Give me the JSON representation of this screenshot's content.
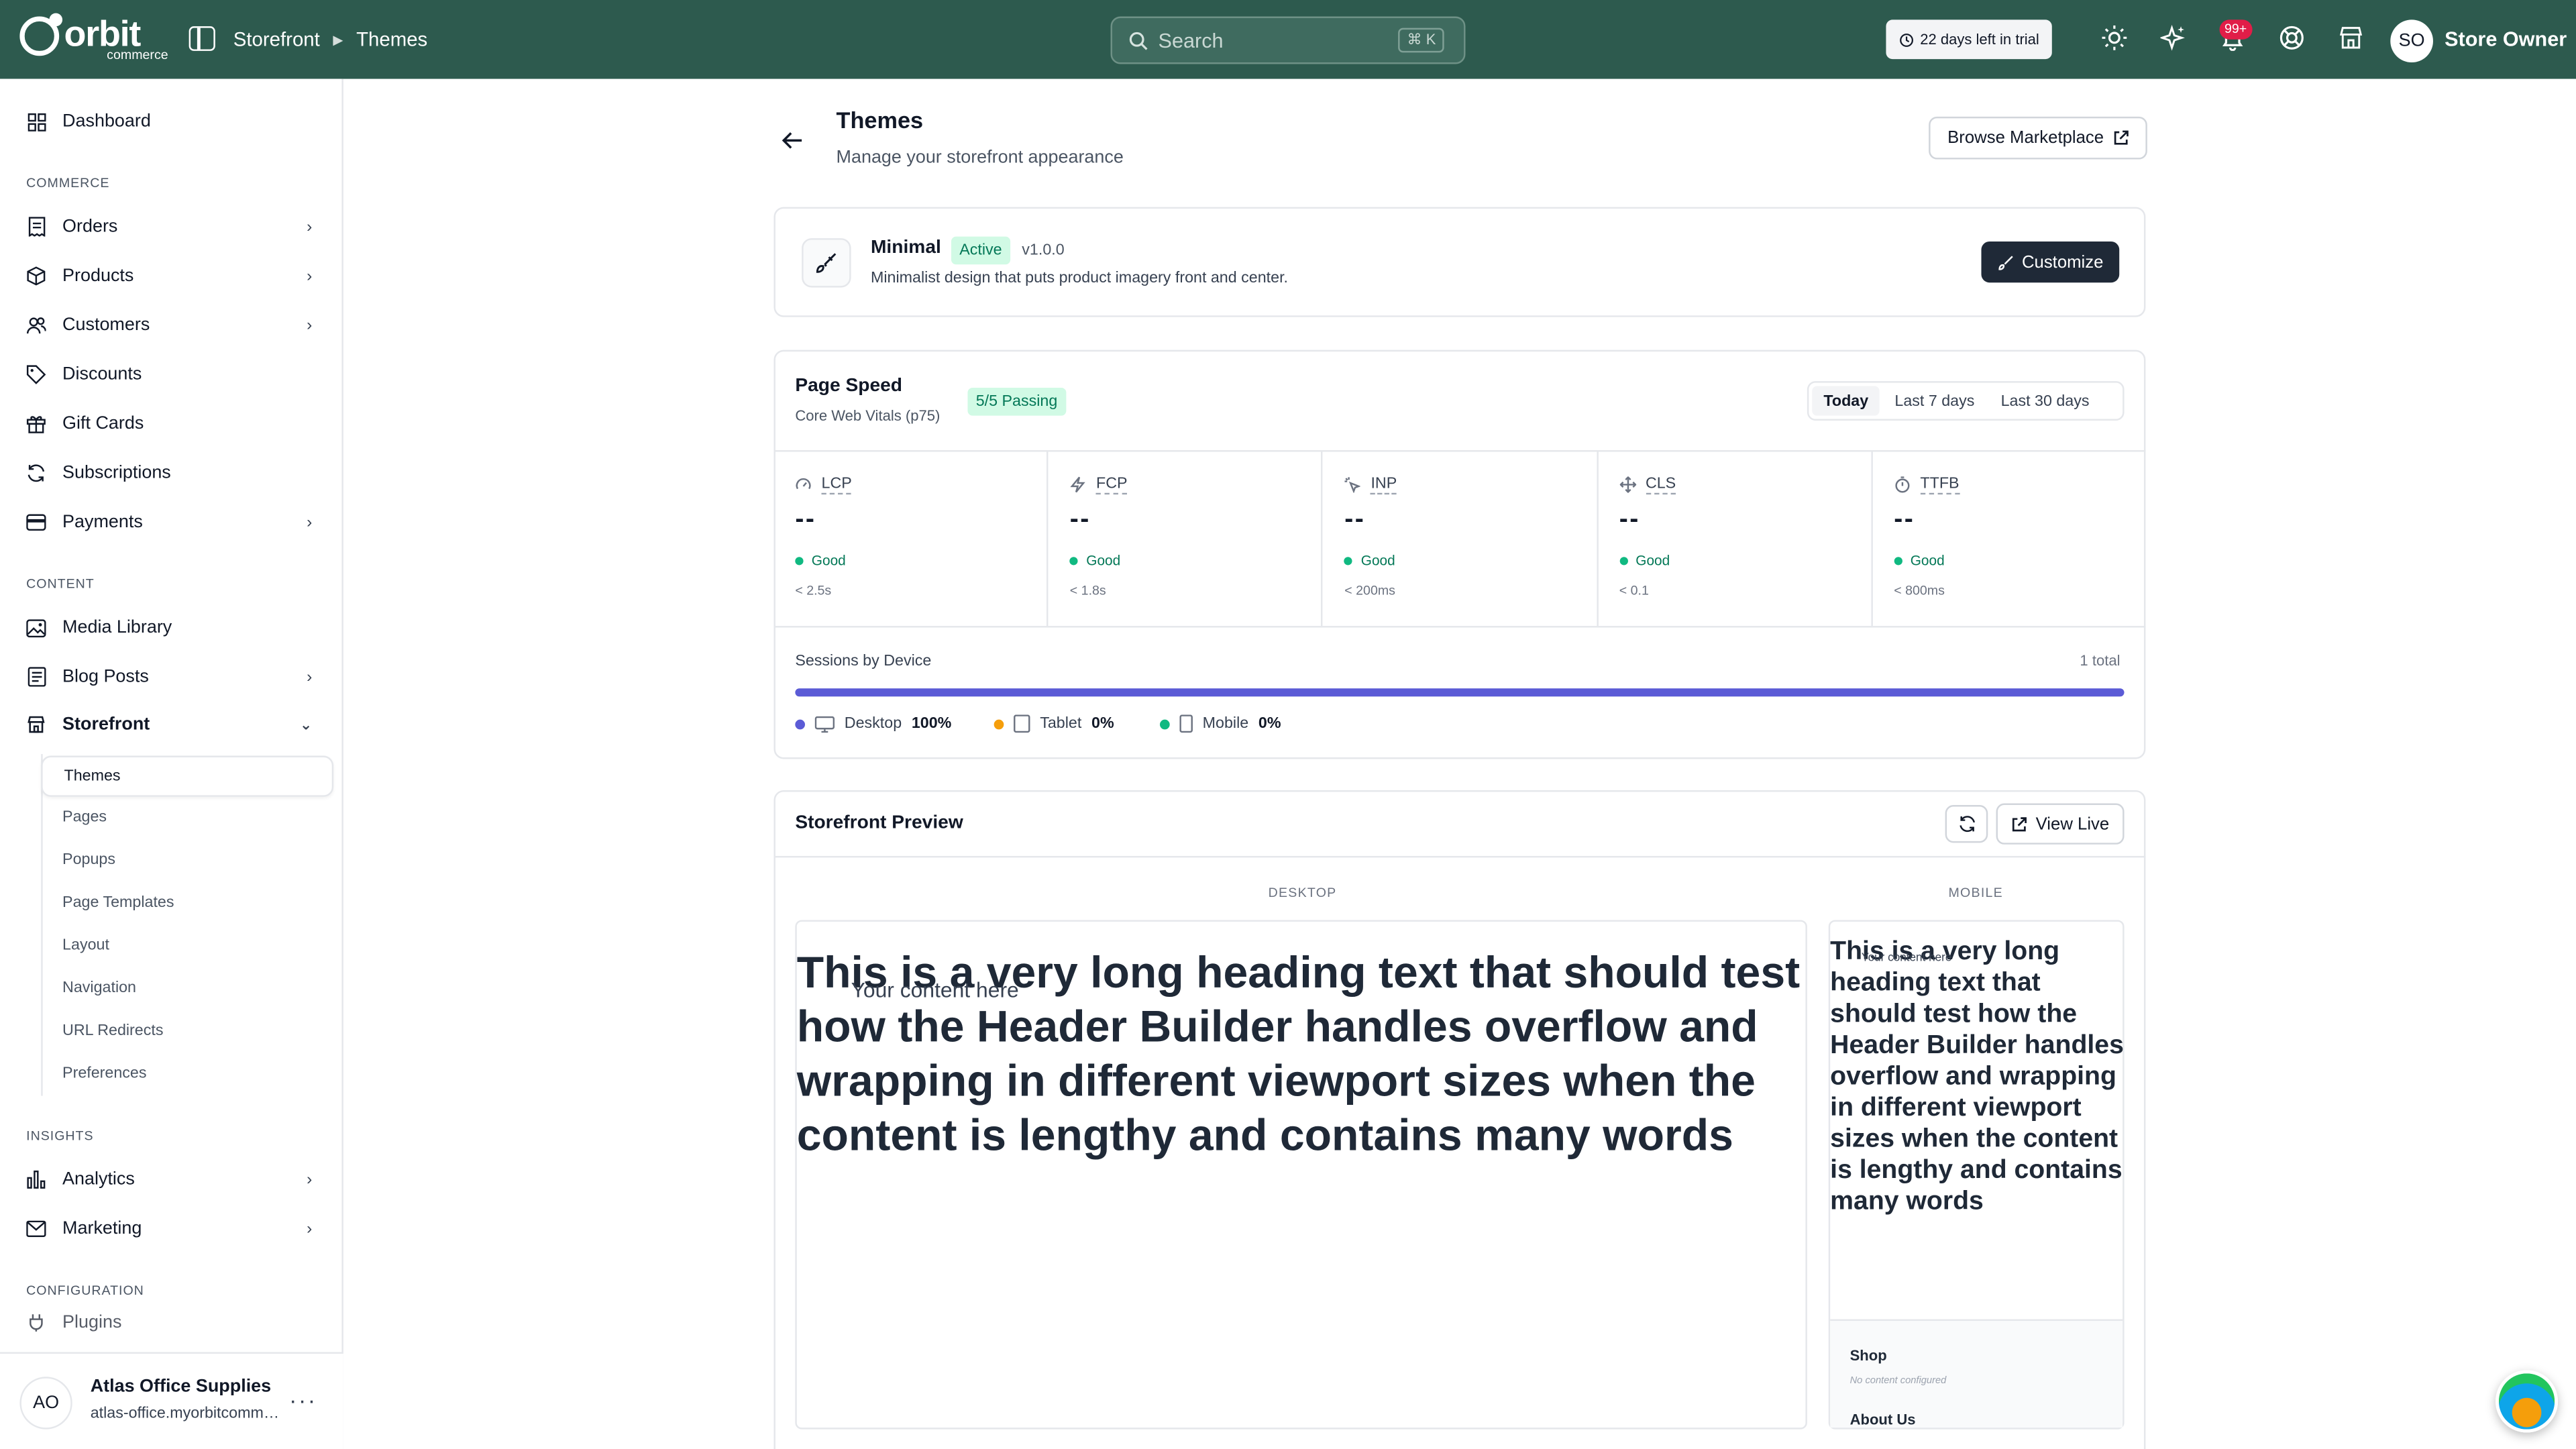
{
  "topbar": {
    "logo_text": "orbit",
    "logo_sub": "commerce",
    "breadcrumb": [
      "Storefront",
      "Themes"
    ],
    "search_placeholder": "Search",
    "search_shortcut": "⌘ K",
    "trial_text": "22 days left in trial",
    "notifications_badge": "99+",
    "avatar_initials": "SO",
    "user_name": "Store Owner"
  },
  "sidebar": {
    "dashboard": "Dashboard",
    "sections": {
      "commerce": "COMMERCE",
      "content": "CONTENT",
      "insights": "INSIGHTS",
      "configuration": "CONFIGURATION"
    },
    "commerce_items": [
      "Orders",
      "Products",
      "Customers",
      "Discounts",
      "Gift Cards",
      "Subscriptions",
      "Payments"
    ],
    "content_items": [
      "Media Library",
      "Blog Posts",
      "Storefront"
    ],
    "storefront_sub": [
      "Themes",
      "Pages",
      "Popups",
      "Page Templates",
      "Layout",
      "Navigation",
      "URL Redirects",
      "Preferences"
    ],
    "insights_items": [
      "Analytics",
      "Marketing"
    ],
    "config_partial": "Plugins",
    "org": {
      "initials": "AO",
      "name": "Atlas Office Supplies",
      "url": "atlas-office.myorbitcommerce.com"
    }
  },
  "page": {
    "title": "Themes",
    "subtitle": "Manage your storefront appearance",
    "browse_button": "Browse Marketplace"
  },
  "theme": {
    "name": "Minimal",
    "status": "Active",
    "version": "v1.0.0",
    "description": "Minimalist design that puts product imagery front and center.",
    "customize_button": "Customize"
  },
  "page_speed": {
    "title": "Page Speed",
    "subtitle": "Core Web Vitals (p75)",
    "passing": "5/5 Passing",
    "ranges": [
      "Today",
      "Last 7 days",
      "Last 30 days"
    ],
    "selected_range": "Today",
    "metrics": [
      {
        "label": "LCP",
        "value": "--",
        "status": "Good",
        "threshold": "< 2.5s"
      },
      {
        "label": "FCP",
        "value": "--",
        "status": "Good",
        "threshold": "< 1.8s"
      },
      {
        "label": "INP",
        "value": "--",
        "status": "Good",
        "threshold": "< 200ms"
      },
      {
        "label": "CLS",
        "value": "--",
        "status": "Good",
        "threshold": "< 0.1"
      },
      {
        "label": "TTFB",
        "value": "--",
        "status": "Good",
        "threshold": "< 800ms"
      }
    ],
    "good_color": "#10b981"
  },
  "sessions": {
    "title": "Sessions by Device",
    "total": "1 total",
    "desktop_fraction": 1.0,
    "devices": [
      {
        "name": "Desktop",
        "pct": "100%",
        "color": "#5b5bd6"
      },
      {
        "name": "Tablet",
        "pct": "0%",
        "color": "#f59e0b"
      },
      {
        "name": "Mobile",
        "pct": "0%",
        "color": "#10b981"
      }
    ]
  },
  "preview": {
    "title": "Storefront Preview",
    "view_live": "View Live",
    "desktop_label": "DESKTOP",
    "mobile_label": "MOBILE",
    "heading": "This is a very long heading text that should test how the Header Builder handles overflow and wrapping in different viewport sizes when the content is lengthy and contains many words",
    "overlay": "Your content here",
    "footer": {
      "shop": "Shop",
      "empty": "No content configured",
      "about": "About Us"
    }
  },
  "colors": {
    "topbar": "#2d5a4e",
    "primary_dark": "#1f2937",
    "accent": "#5b5bd6",
    "badge": "#e11d48"
  }
}
